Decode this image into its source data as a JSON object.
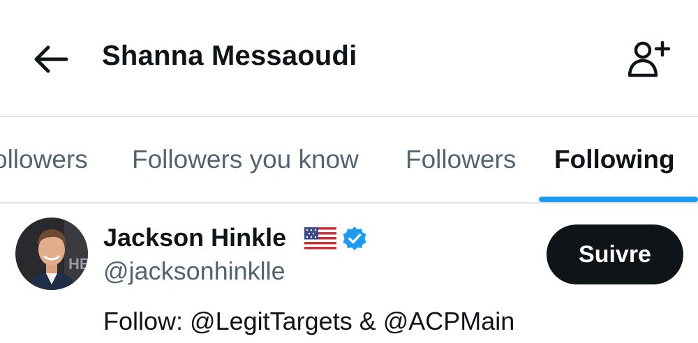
{
  "header": {
    "title": "Shanna Messaoudi",
    "back_icon": "arrow-left-icon",
    "follow_icon": "add-user-icon"
  },
  "tabs": [
    {
      "label": "ollowers",
      "active": false
    },
    {
      "label": "Followers you know",
      "active": false
    },
    {
      "label": "Followers",
      "active": false
    },
    {
      "label": "Following",
      "active": true
    }
  ],
  "user": {
    "name": "Jackson Hinkle",
    "flag_icon": "us-flag-icon",
    "verified_icon": "verified-badge-icon",
    "handle": "@jacksonhinklle",
    "bio": "Follow: @LegitTargets & @ACPMain",
    "follow_button_label": "Suivre",
    "avatar_backdrop_text": "HB"
  },
  "colors": {
    "accent": "#1d9bf0",
    "text_primary": "#0f1419",
    "text_secondary": "#536471",
    "divider": "#e1e6ea",
    "button_bg": "#0f1419",
    "button_text": "#ffffff"
  }
}
